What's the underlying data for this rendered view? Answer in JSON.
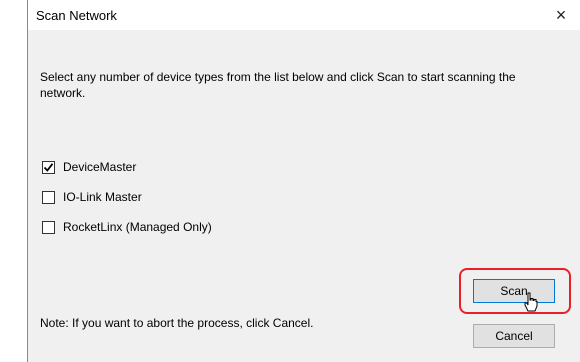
{
  "dialog": {
    "title": "Scan Network",
    "close_glyph": "×",
    "instructions": "Select any number of device types from the list below and click Scan to start scanning the network.",
    "device_types": [
      {
        "label": "DeviceMaster",
        "checked": true
      },
      {
        "label": "IO-Link Master",
        "checked": false
      },
      {
        "label": "RocketLinx (Managed Only)",
        "checked": false
      }
    ],
    "note": "Note: If you want to abort the process, click Cancel.",
    "scan_label": "Scan",
    "cancel_label": "Cancel"
  },
  "icons": {
    "close": "close-icon",
    "check": "checkmark-icon",
    "cursor": "pointer-hand-icon"
  },
  "colors": {
    "highlight": "#e8202a",
    "default_button_border": "#0078d7",
    "window_border": "#6b8ec3"
  }
}
